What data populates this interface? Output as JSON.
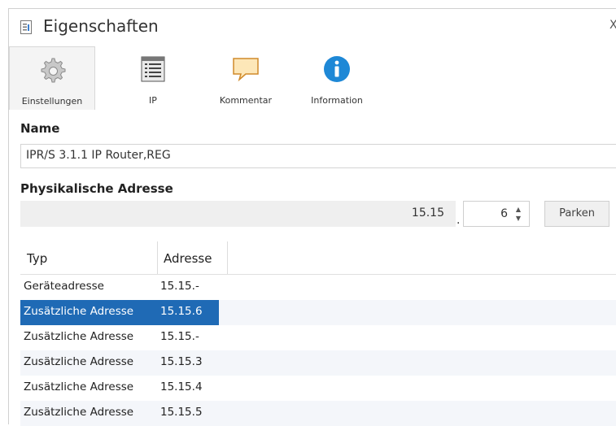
{
  "window": {
    "title": "Eigenschaften",
    "close_glyph": "X"
  },
  "tabs": [
    {
      "label": "Einstellungen",
      "icon": "gear-icon",
      "active": true
    },
    {
      "label": "IP",
      "icon": "list-icon",
      "active": false
    },
    {
      "label": "Kommentar",
      "icon": "comment-icon",
      "active": false
    },
    {
      "label": "Information",
      "icon": "info-icon",
      "active": false
    }
  ],
  "name_section": {
    "label": "Name",
    "value": "IPR/S 3.1.1 IP Router,REG"
  },
  "address_section": {
    "label": "Physikalische Adresse",
    "prefix": "15.15",
    "separator": ".",
    "device_number": "6",
    "park_button": "Parken"
  },
  "table": {
    "columns": [
      "Typ",
      "Adresse"
    ],
    "rows": [
      {
        "typ": "Geräteadresse",
        "adresse": "15.15.-",
        "selected": false
      },
      {
        "typ": "Zusätzliche Adresse",
        "adresse": "15.15.6",
        "selected": true
      },
      {
        "typ": "Zusätzliche Adresse",
        "adresse": "15.15.-",
        "selected": false
      },
      {
        "typ": "Zusätzliche Adresse",
        "adresse": "15.15.3",
        "selected": false
      },
      {
        "typ": "Zusätzliche Adresse",
        "adresse": "15.15.4",
        "selected": false
      },
      {
        "typ": "Zusätzliche Adresse",
        "adresse": "15.15.5",
        "selected": false
      }
    ]
  },
  "colors": {
    "selection": "#1f6ab5",
    "accent_info": "#1e88d6",
    "comment_fill": "#fde7b8"
  }
}
